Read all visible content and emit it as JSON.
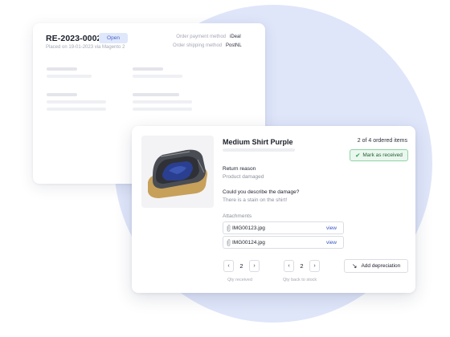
{
  "order": {
    "id": "RE-2023-0002",
    "status": "Open",
    "placed_on": "Placed on 19-01-2023 via Magento 2",
    "payment_label": "Order payment method",
    "payment_value": "iDeal",
    "shipping_label": "Order shipping method",
    "shipping_value": "PostNL"
  },
  "item": {
    "title": "Medium Shirt Purple",
    "count": "2 of 4 ordered items",
    "mark_received": "Mark as received",
    "return_reason_label": "Return reason",
    "return_reason_value": "Product damaged",
    "damage_question": "Could you describe the damage?",
    "damage_answer": "There is a stain on the shirt!",
    "attachments_label": "Attachments",
    "attachments": [
      {
        "name": "IMG00123.jpg",
        "action": "view"
      },
      {
        "name": "IMG00124.jpg",
        "action": "view"
      }
    ],
    "qty_received": {
      "value": "2",
      "caption": "Qty received"
    },
    "qty_back_to_stock": {
      "value": "2",
      "caption": "Qty back to stock"
    },
    "add_depreciation": "Add depreciation"
  },
  "icons": {
    "decrement": "‹",
    "increment": "›",
    "check": "✔",
    "paperclip": "⌕",
    "depreciation": "↘"
  },
  "colors": {
    "accent": "#3a57c4",
    "success": "#27a24f",
    "badge_bg": "#dfe7fb",
    "background_circle": "#dfe6fa"
  }
}
